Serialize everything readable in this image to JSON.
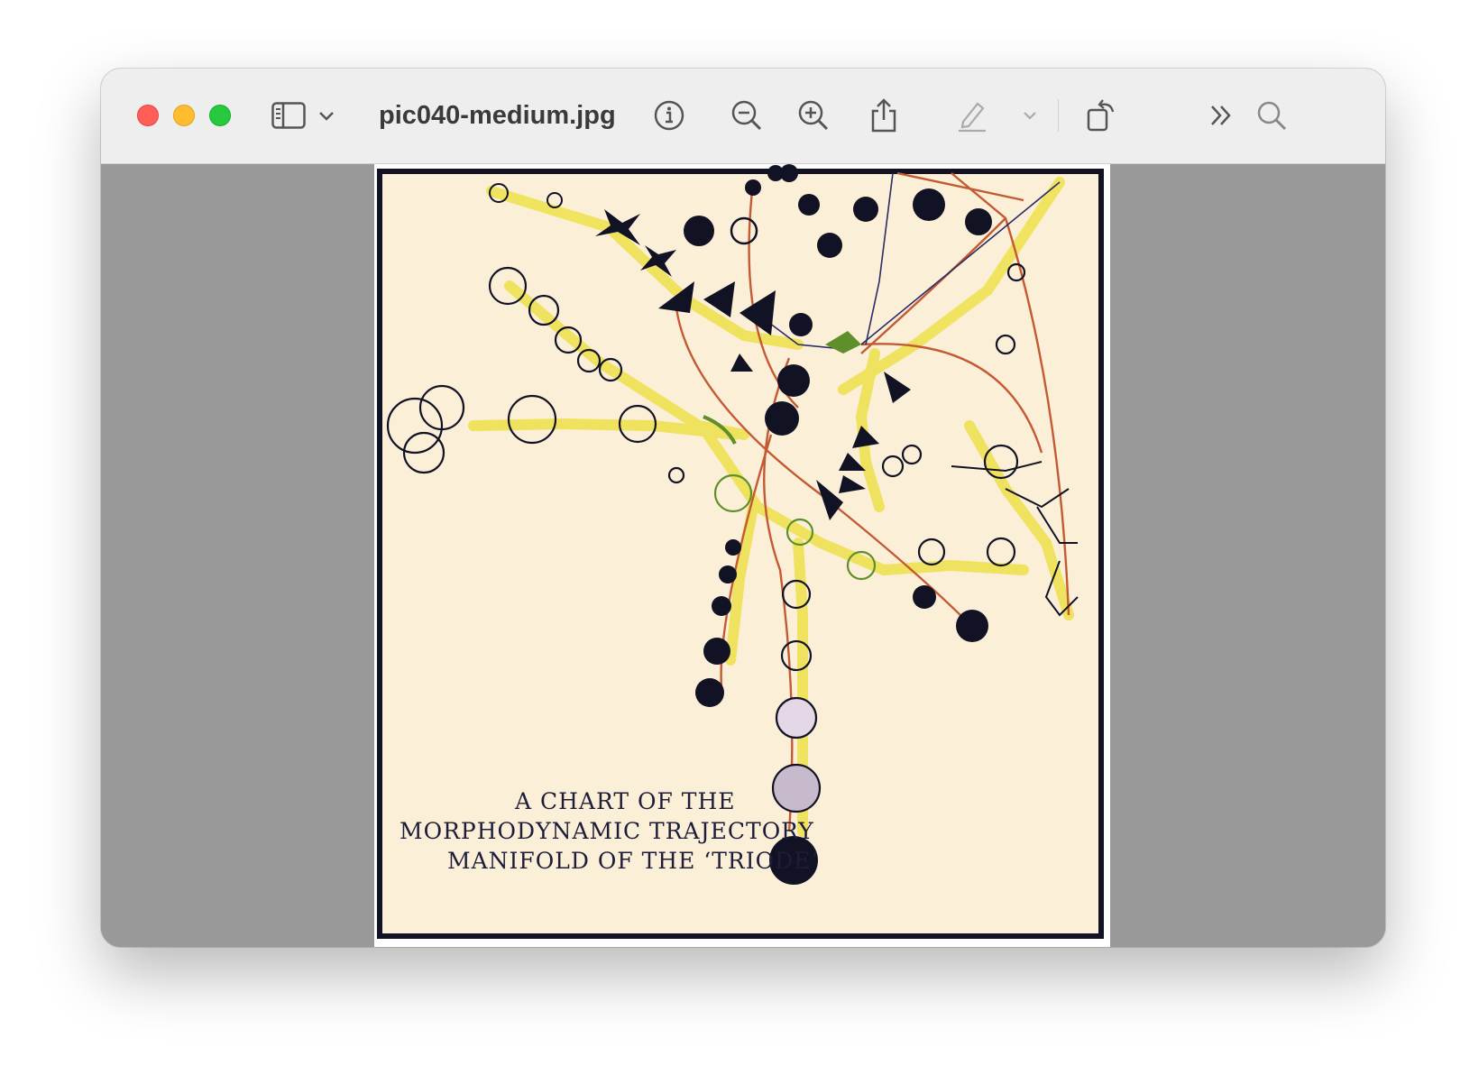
{
  "window": {
    "title": "pic040-medium.jpg",
    "traffic_lights": [
      "close",
      "minimize",
      "zoom"
    ]
  },
  "toolbar": {
    "icons": [
      "sidebar-icon",
      "chevron-down-icon",
      "info-icon",
      "zoom-out-icon",
      "zoom-in-icon",
      "share-icon",
      "markup-pen-icon",
      "chevron-down-icon",
      "rotate-icon",
      "more-chevrons-icon",
      "search-icon"
    ]
  },
  "image": {
    "caption_lines": [
      "A CHART OF THE",
      "MORPHODYNAMIC TRAJECTORY",
      "MANIFOLD OF THE ‘TRIODE’"
    ]
  },
  "colors": {
    "paper": "#fcefd8",
    "ink": "#121225",
    "highlight": "#ece04a",
    "red_lines": "#c45a33",
    "backdrop": "#999999"
  }
}
